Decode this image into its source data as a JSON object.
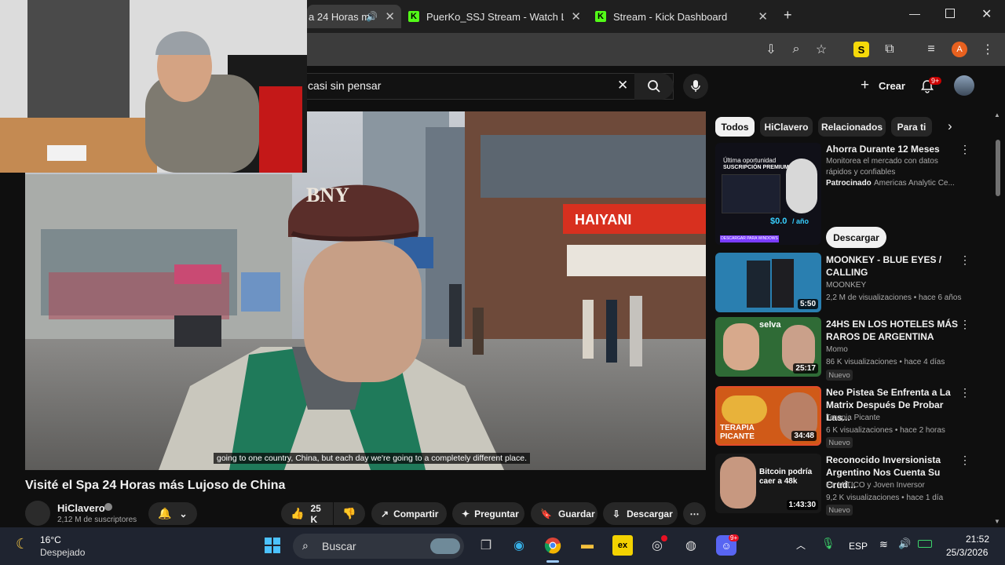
{
  "browser": {
    "tabs": [
      {
        "title": "a 24 Horas m",
        "active": true
      },
      {
        "title": "PuerKo_SSJ Stream - Watch Live",
        "active": false
      },
      {
        "title": "Stream - Kick Dashboard",
        "active": false
      }
    ],
    "new_tab": "+",
    "profile_initial": "A"
  },
  "youtube": {
    "search_value": "casi sin pensar",
    "create_label": "Crear",
    "notif_count": "9+",
    "caption": "going to one country, China, but each day we're going to a completely different place.",
    "video_title": "Visité el Spa 24 Horas más Lujoso de China",
    "channel_name": "HiClavero",
    "subscribers": "2,12 M de suscriptores",
    "likes": "25 K",
    "share": "Compartir",
    "ask": "Preguntar",
    "save": "Guardar",
    "download": "Descargar",
    "video_sign1": "BNY",
    "video_sign2": "HAIYANI"
  },
  "sidebar": {
    "chips": [
      "Todos",
      "HiClavero",
      "Relacionados",
      "Para ti"
    ],
    "ad": {
      "title": "Ahorra Durante 12 Meses",
      "desc": "Monitorea el mercado con datos rápidos y confiables",
      "sponsor": "Patrocinado",
      "advertiser": "Americas Analytic Ce...",
      "button": "Descargar",
      "thumb_line1": "Última oportunidad",
      "thumb_line2": "SUSCRIPCIÓN PREMIUM",
      "thumb_price": "$0.0",
      "thumb_price_unit": "/ año",
      "thumb_cta": "DESCARGAR PARA WINDOWS"
    },
    "videos": [
      {
        "title": "MOONKEY - BLUE EYES / CALLING",
        "channel": "MOONKEY",
        "meta": "2,2 M de visualizaciones • hace 6 años",
        "duration": "5:50",
        "new": "",
        "thumb_text": ""
      },
      {
        "title": "24HS EN LOS HOTELES MÁS RAROS DE ARGENTINA",
        "channel": "Momo",
        "meta": "86 K visualizaciones • hace 4 días",
        "duration": "25:17",
        "new": "Nuevo",
        "thumb_text": "selva"
      },
      {
        "title": "Neo Pistea Se Enfrenta a La Matrix Después De Probar Las...",
        "channel": "Terapia Picante",
        "meta": "6 K visualizaciones • hace 2 horas",
        "duration": "34:48",
        "new": "Nuevo",
        "thumb_text": "TERAPIA PICANTE"
      },
      {
        "title": "Reconocido Inversionista Argentino Nos Cuenta Su Crud...",
        "channel": "EL MÍTICO y Joven Inversor",
        "meta": "9,2 K visualizaciones • hace 1 día",
        "duration": "1:43:30",
        "new": "Nuevo",
        "thumb_text": "Bitcoin podría caer a 48k"
      }
    ]
  },
  "taskbar": {
    "weather_temp": "16°C",
    "weather_desc": "Despejado",
    "search_placeholder": "Buscar",
    "lang": "ESP",
    "time": "21:52",
    "date": "25/3/2026",
    "discord_badge": "9+"
  }
}
